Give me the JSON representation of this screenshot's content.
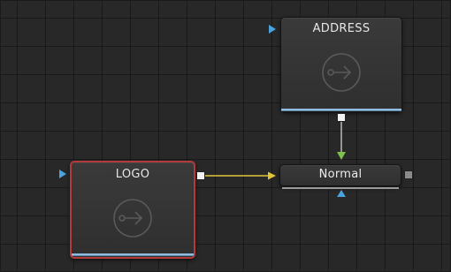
{
  "nodes": {
    "address": {
      "title": "ADDRESS",
      "icon": "media-in-icon"
    },
    "logo": {
      "title": "LOGO",
      "icon": "media-in-icon",
      "selected": true
    },
    "normal": {
      "title": "Normal"
    }
  },
  "colors": {
    "background": "#282828",
    "selection_border": "#b23a3a",
    "input_port": "#4aa3df",
    "foreground_link": "#e0c43a",
    "link_green": "#7fc04a",
    "link_gray": "#cfcfcf",
    "node_underline": "#8fbcdf"
  },
  "connections": [
    {
      "from": "LOGO",
      "to": "Normal",
      "color": "yellow"
    },
    {
      "from": "ADDRESS",
      "to": "Normal",
      "color": "gray"
    }
  ]
}
